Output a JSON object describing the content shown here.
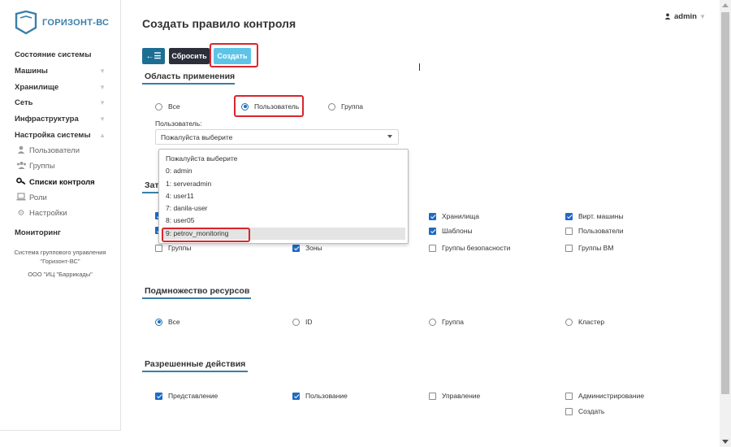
{
  "brand": {
    "name": "ГОРИЗОНТ-ВС"
  },
  "sidebar": {
    "items": [
      {
        "label": "Состояние системы",
        "chevron": false
      },
      {
        "label": "Машины",
        "chevron": true
      },
      {
        "label": "Хранилище",
        "chevron": true
      },
      {
        "label": "Сеть",
        "chevron": true
      },
      {
        "label": "Инфраструктура",
        "chevron": true
      },
      {
        "label": "Настройка системы",
        "chevron": true,
        "expanded": true
      }
    ],
    "subitems": [
      {
        "label": "Пользователи",
        "icon": "user-icon"
      },
      {
        "label": "Группы",
        "icon": "users-icon"
      },
      {
        "label": "Списки контроля",
        "icon": "key-icon",
        "active": true
      },
      {
        "label": "Роли",
        "icon": "laptop-icon"
      },
      {
        "label": "Настройки",
        "icon": "gear-icon"
      }
    ],
    "monitoring": "Мониторинг",
    "footer_line1": "Система группового управления",
    "footer_line2": "\"Горизонт-ВС\"",
    "footer_company": "ООО \"ИЦ \"Баррикады\""
  },
  "header": {
    "title": "Создать правило контроля",
    "user": "admin"
  },
  "toolbar": {
    "back_icon": "←☰",
    "reset_label": "Сбросить",
    "create_label": "Создать"
  },
  "scope": {
    "title": "Область применения",
    "options": [
      "Все",
      "Пользователь",
      "Группа"
    ],
    "selected": "Пользователь",
    "field_label": "Пользователь:",
    "select_value": "Пожалуйста выберите",
    "dropdown": [
      "Пожалуйста выберите",
      "0: admin",
      "1: serveradmin",
      "4: user11",
      "7: danila-user",
      "8: user05",
      "9: petrov_monitoring"
    ],
    "dropdown_selected": "9: petrov_monitoring"
  },
  "affected": {
    "title_visible": "Зат",
    "visible_items": [
      {
        "label": "Хранилища",
        "checked": true
      },
      {
        "label": "Вирт. машины",
        "checked": true
      },
      {
        "label": "Шаблоны",
        "checked": true
      },
      {
        "label": "Пользователи",
        "checked": false
      },
      {
        "label": "Группы",
        "checked": false
      },
      {
        "label": "Зоны",
        "checked": true
      },
      {
        "label": "Группы безопасности",
        "checked": false
      },
      {
        "label": "Группы ВМ",
        "checked": false
      }
    ]
  },
  "subset": {
    "title": "Подмножество ресурсов",
    "options": [
      "Все",
      "ID",
      "Группа",
      "Кластер"
    ],
    "selected": "Все"
  },
  "actions": {
    "title": "Разрешенные действия",
    "items": [
      {
        "label": "Представление",
        "checked": true
      },
      {
        "label": "Пользование",
        "checked": true
      },
      {
        "label": "Управление",
        "checked": false
      },
      {
        "label": "Администрирование",
        "checked": false
      },
      {
        "label": "Создать",
        "checked": false
      }
    ]
  },
  "colors": {
    "accent": "#1d6e94",
    "dark_button": "#2b2f3a",
    "create_button": "#5dc4e8",
    "highlight": "#d8262c",
    "section_line": "#3a7fa7",
    "checkbox": "#1f6ac4"
  }
}
